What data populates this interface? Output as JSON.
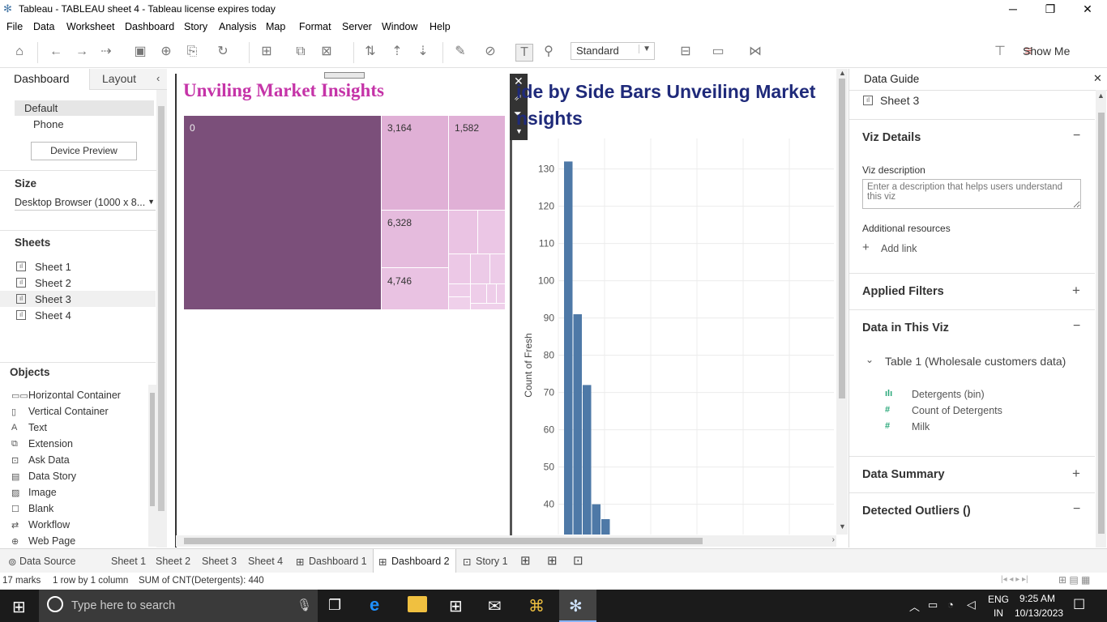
{
  "window": {
    "title": "Tableau - TABLEAU sheet 4 - Tableau license expires today",
    "minimize": "─",
    "restore": "❐",
    "close": "✕"
  },
  "menu": [
    "File",
    "Data",
    "Worksheet",
    "Dashboard",
    "Story",
    "Analysis",
    "Map",
    "Format",
    "Server",
    "Window",
    "Help"
  ],
  "toolbar": {
    "fit_dropdown": "Standard",
    "show_me": "Show Me"
  },
  "left_panel": {
    "tabs": [
      "Dashboard",
      "Layout"
    ],
    "devices": [
      "Default",
      "Phone"
    ],
    "device_preview": "Device Preview",
    "size_heading": "Size",
    "size_value": "Desktop Browser (1000 x 8...",
    "sheets_heading": "Sheets",
    "sheets": [
      "Sheet 1",
      "Sheet 2",
      "Sheet 3",
      "Sheet 4"
    ],
    "objects_heading": "Objects",
    "objects": [
      {
        "label": "Horizontal Container",
        "icon": "horizontal-container-icon",
        "glyph": "▭▭"
      },
      {
        "label": "Vertical Container",
        "icon": "vertical-container-icon",
        "glyph": "▯"
      },
      {
        "label": "Text",
        "icon": "text-icon",
        "glyph": "A"
      },
      {
        "label": "Extension",
        "icon": "extension-icon",
        "glyph": "⧉"
      },
      {
        "label": "Ask Data",
        "icon": "ask-data-icon",
        "glyph": "⊡"
      },
      {
        "label": "Data Story",
        "icon": "data-story-icon",
        "glyph": "▤"
      },
      {
        "label": "Image",
        "icon": "image-icon",
        "glyph": "▨"
      },
      {
        "label": "Blank",
        "icon": "blank-icon",
        "glyph": "☐"
      },
      {
        "label": "Workflow",
        "icon": "workflow-icon",
        "glyph": "⇄"
      },
      {
        "label": "Web Page",
        "icon": "web-page-icon",
        "glyph": "⊕"
      }
    ]
  },
  "dashboard": {
    "treemap_title": "Unviling Market Insights",
    "treemap_labels": [
      "0",
      "3,164",
      "1,582",
      "6,328",
      "4,746"
    ],
    "hist_title_line1": "ide by Side Bars Unveiling Market",
    "hist_title_line2": "nsights",
    "hist_ylabel": "Count of Fresh",
    "colors": {
      "treemap_dark": "#7b4f7a",
      "treemap_light": "#e0b0d6",
      "treemap_lighter": "#e9c2e2",
      "bar": "#4e79a7",
      "title_pink": "#c534a8",
      "title_navy": "#1f2a7a"
    }
  },
  "chart_data": {
    "type": "bar",
    "title": "ide by Side Bars Unveiling Market nsights",
    "ylabel": "Count of Fresh",
    "xlabel": "",
    "yticks": [
      40,
      50,
      60,
      70,
      80,
      90,
      100,
      110,
      120,
      130
    ],
    "ylim": [
      35,
      135
    ],
    "values": [
      132,
      91,
      72,
      40,
      36
    ]
  },
  "right_panel": {
    "title": "Data Guide",
    "sheet": "Sheet 3",
    "viz_details": "Viz Details",
    "viz_description_label": "Viz description",
    "viz_description_placeholder": "Enter a description that helps users understand this viz",
    "additional_resources": "Additional resources",
    "add_link": "Add link",
    "applied_filters": "Applied Filters",
    "data_in_viz": "Data in This Viz",
    "table": "Table 1 (Wholesale customers data)",
    "fields": [
      {
        "label": "Detergents (bin)",
        "icon": "bin-icon",
        "glyph": "ılı"
      },
      {
        "label": "Count of Detergents",
        "icon": "measure-icon",
        "glyph": "#"
      },
      {
        "label": "Milk",
        "icon": "measure-icon",
        "glyph": "#"
      }
    ],
    "data_summary": "Data Summary",
    "detected_outliers": "Detected Outliers ()"
  },
  "bottom_tabs": [
    "Data Source",
    "Sheet 1",
    "Sheet 2",
    "Sheet 3",
    "Sheet 4",
    "Dashboard 1",
    "Dashboard 2",
    "Story 1"
  ],
  "active_tab": "Dashboard 2",
  "status": {
    "marks": "17 marks",
    "rows": "1 row by 1 column",
    "sum": "SUM of CNT(Detergents): 440"
  },
  "taskbar": {
    "search_placeholder": "Type here to search",
    "lang": "ENG",
    "region": "IN",
    "time": "9:25 AM",
    "date": "10/13/2023"
  }
}
